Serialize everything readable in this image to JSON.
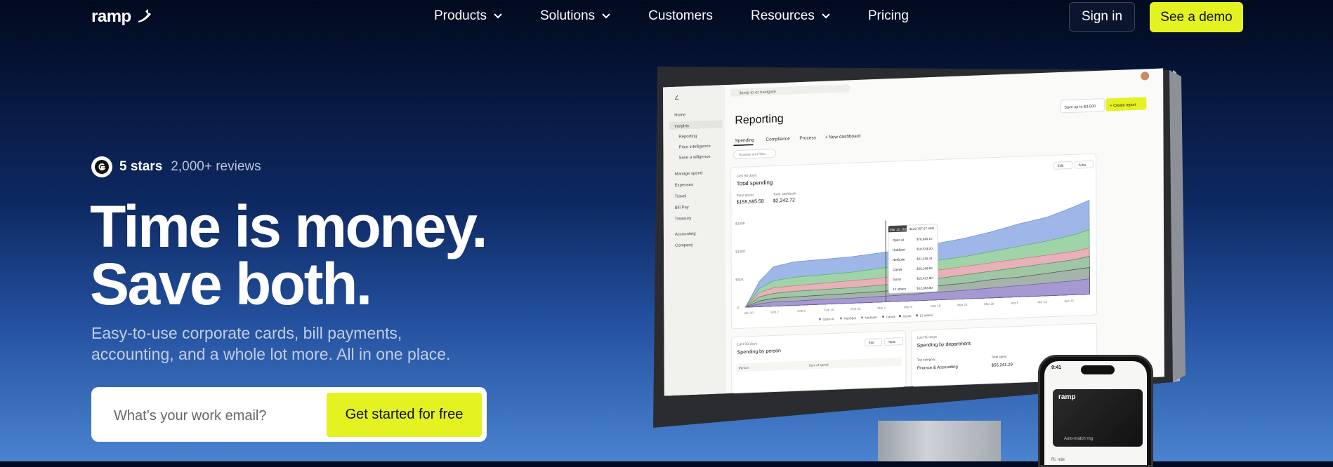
{
  "nav": {
    "brand": "ramp",
    "links": [
      {
        "label": "Products",
        "dropdown": true
      },
      {
        "label": "Solutions",
        "dropdown": true
      },
      {
        "label": "Customers",
        "dropdown": false
      },
      {
        "label": "Resources",
        "dropdown": true
      },
      {
        "label": "Pricing",
        "dropdown": false
      }
    ],
    "sign_in": "Sign in",
    "demo": "See a demo"
  },
  "hero": {
    "rating_stars": "5 stars",
    "rating_reviews": "2,000+ reviews",
    "headline_line1": "Time is money.",
    "headline_line2": "Save both.",
    "subtitle_line1": "Easy-to-use corporate cards, bill payments,",
    "subtitle_line2": "accounting, and a whole lot more. All in one place.",
    "email_placeholder": "What’s your work email?",
    "cta": "Get started for free"
  },
  "dashboard": {
    "search": "Jump to or navigate",
    "sidebar": [
      "Home",
      "Insights",
      "Reporting",
      "Price intelligence",
      "Save a willgence",
      "Manage spend",
      "Expenses",
      "Travel",
      "Bill Pay",
      "Treasury",
      "Accounting",
      "Company"
    ],
    "page_title": "Reporting",
    "save_badge": "Save up to $3,500",
    "create_report": "+ Create report",
    "tabs": [
      "Spending",
      "Compliance",
      "Process",
      "+ New dashboard"
    ],
    "search_filter": "Browse and filter...",
    "chart_period": "Last 90 days",
    "chart_title": "Total spending",
    "total_spent_label": "Total spent",
    "total_spent_value": "$155,585.58",
    "cashback_label": "Total cashback",
    "cashback_value": "$2,242.72",
    "edit": "Edit",
    "area": "Area",
    "tooltip_date": "Mar 12, 2025",
    "tooltip_total": "$120,767.67 total",
    "tooltip_rows": [
      {
        "name": "Open AI",
        "value": "$78,645.10"
      },
      {
        "name": "HubSpot",
        "value": "$18,534.00"
      },
      {
        "name": "NetSuite",
        "value": "$21,236.41"
      },
      {
        "name": "Canva",
        "value": "$26,168.66"
      },
      {
        "name": "Gusto",
        "value": "$15,422.80"
      },
      {
        "name": "12 others",
        "value": "$13,083.80"
      }
    ],
    "y_ticks": [
      "$150K",
      "$100K",
      "$50K",
      "0"
    ],
    "x_ticks": [
      "Jan 20",
      "Feb 2",
      "Feb 9",
      "Feb 16",
      "Feb 23",
      "Mar 2",
      "Mar 9",
      "Mar 16",
      "Mar 23",
      "Mar 30",
      "Apr 6",
      "Apr 13",
      "Apr 20"
    ],
    "legend": [
      "Open AI",
      "HubSpot",
      "NetSuite",
      "Canva",
      "Gusto",
      "12 others"
    ],
    "bottom_left_period": "Last 90 days",
    "bottom_left_title": "Spending by person",
    "bottom_left_col1": "Person",
    "bottom_left_col2": "Sum of spend",
    "bottom_left_edit": "Edit",
    "bottom_left_table": "Table",
    "bottom_right_period": "Last 90 days",
    "bottom_right_title": "Spending by department",
    "bottom_right_col1": "Top category",
    "bottom_right_col2": "Total spent",
    "bottom_right_row": "Finance & Accounting",
    "bottom_right_value": "$55,241.29"
  },
  "phone": {
    "time": "9:41",
    "card_brand": "ramp",
    "card_label": "Auto-match rng",
    "bottom_label": "Ri. nde"
  },
  "colors": {
    "accent": "#e4f222",
    "series": [
      "#9eb7e8",
      "#9fd4a8",
      "#e8b0b8",
      "#9fc7a5",
      "#a4b4a8",
      "#a698d0"
    ]
  }
}
